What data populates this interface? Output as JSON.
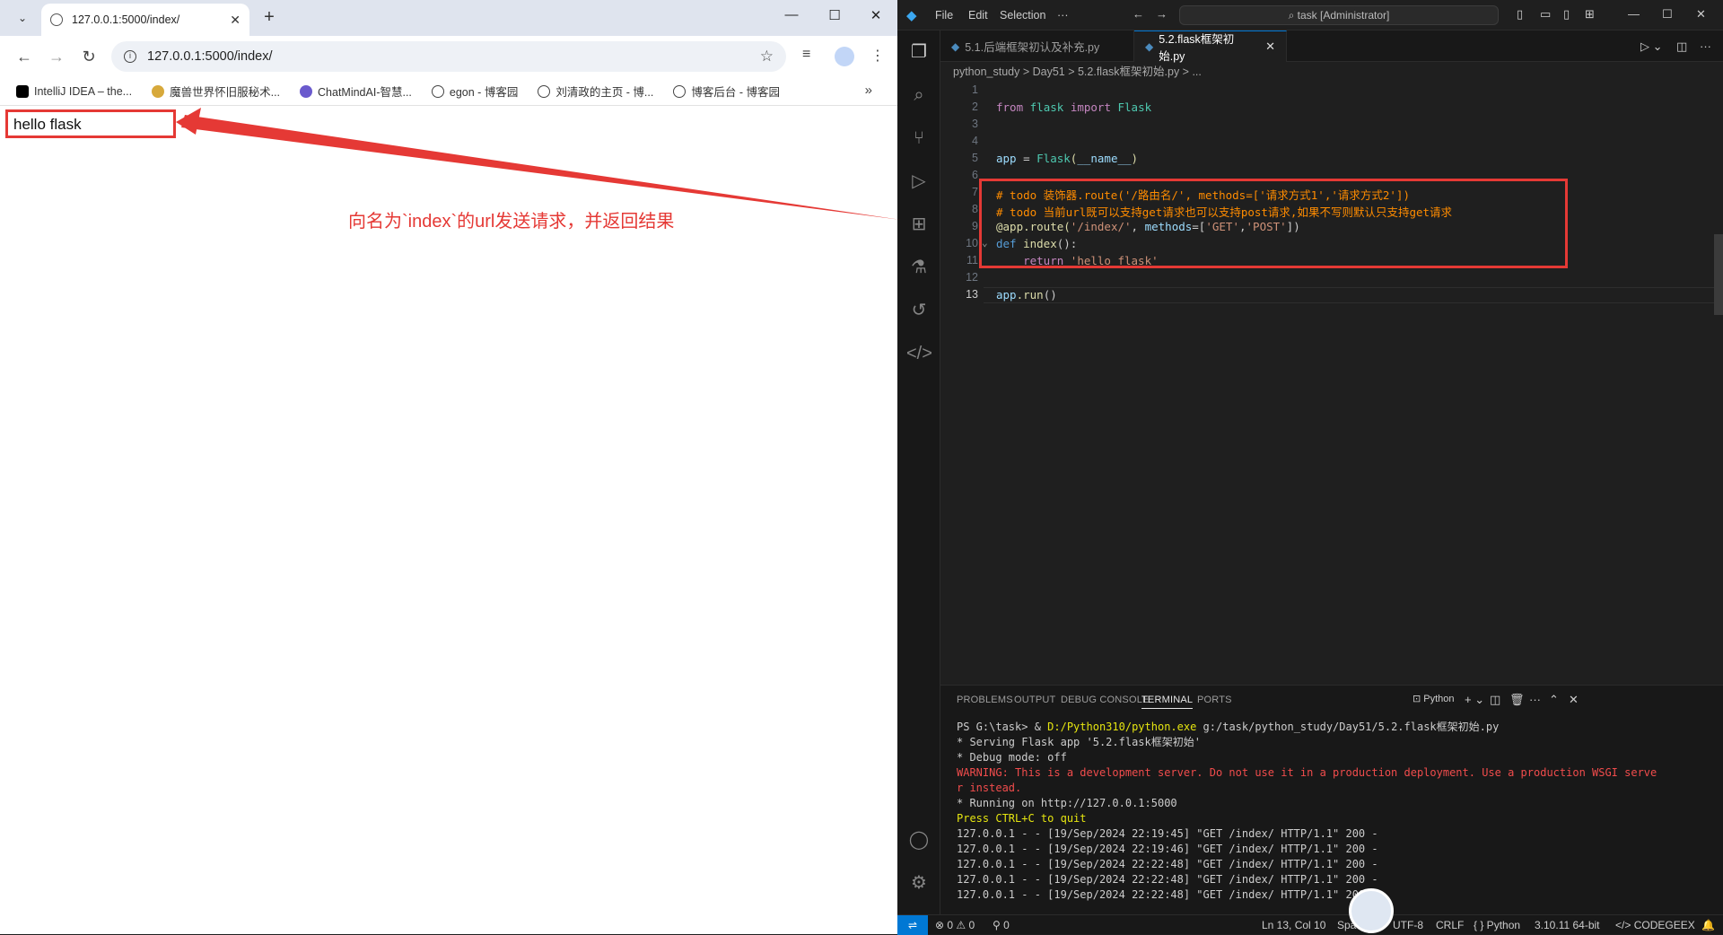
{
  "browser": {
    "tab_title": "127.0.0.1:5000/index/",
    "url": "127.0.0.1:5000/index/",
    "bookmarks": [
      {
        "label": "IntelliJ IDEA – the...",
        "color": "#000000"
      },
      {
        "label": "魔兽世界怀旧服秘术...",
        "color": "#d7a93b"
      },
      {
        "label": "ChatMindAI-智慧...",
        "color": "#6a5acd"
      },
      {
        "label": "egon - 博客园",
        "color": "#444444"
      },
      {
        "label": "刘清政的主页 - 博...",
        "color": "#444444"
      },
      {
        "label": "博客后台 - 博客园",
        "color": "#444444"
      }
    ],
    "page_text": "hello flask",
    "annotation": "向名为`index`的url发送请求，并返回结果"
  },
  "vscode": {
    "menu": [
      "File",
      "Edit",
      "Selection",
      "···"
    ],
    "command_center": "task [Administrator]",
    "tabs": [
      {
        "label": "5.1.后端框架初认及补充.py",
        "active": false
      },
      {
        "label": "5.2.flask框架初始.py",
        "active": true
      }
    ],
    "breadcrumb": "python_study  >  Day51  >  5.2.flask框架初始.py  >  ...",
    "line_numbers": [
      "1",
      "2",
      "3",
      "4",
      "5",
      "6",
      "7",
      "8",
      "9",
      "10",
      "11",
      "12",
      "13"
    ],
    "code": {
      "l2_from": "from",
      "l2_mod": "flask",
      "l2_import": "import",
      "l2_cls": "Flask",
      "l5_var": "app",
      "l5_eq": " = ",
      "l5_cls": "Flask",
      "l5_paren_open": "(",
      "l5_arg": "__name__",
      "l5_paren_close": ")",
      "l7": "# todo 装饰器.route('/路由名/', methods=['请求方式1','请求方式2'])",
      "l8": "# todo 当前url既可以支持get请求也可以支持post请求,如果不写则默认只支持get请求",
      "l9_at": "@app.route(",
      "l9_route": "'/index/'",
      "l9_mid": ", ",
      "l9_kw": "methods",
      "l9_eq": "=[",
      "l9_get": "'GET'",
      "l9_comma": ",",
      "l9_post": "'POST'",
      "l9_end": "])",
      "l10_def": "def",
      "l10_fn": "index",
      "l10_end": "():",
      "l11_ret": "return",
      "l11_str": "'hello flask'",
      "l13_var": "app",
      "l13_fn": ".run",
      "l13_end": "()"
    },
    "panel_tabs": [
      "PROBLEMS",
      "OUTPUT",
      "DEBUG CONSOLE",
      "TERMINAL",
      "PORTS"
    ],
    "terminal_profile": "Python",
    "terminal": {
      "prompt": "PS G:\\task> & ",
      "exe": "D:/Python310/python.exe",
      "script": " g:/task/python_study/Day51/5.2.flask框架初始.py",
      "serving": " * Serving Flask app '5.2.flask框架初始'",
      "debug": " * Debug mode: off",
      "warning1": "WARNING: This is a development server. Do not use it in a production deployment. Use a production WSGI serve",
      "warning2": "r instead.",
      "running": " * Running on http://127.0.0.1:5000",
      "quit": "Press CTRL+C to quit",
      "logs": [
        "127.0.0.1 - - [19/Sep/2024 22:19:45] \"GET /index/ HTTP/1.1\" 200 -",
        "127.0.0.1 - - [19/Sep/2024 22:19:46] \"GET /index/ HTTP/1.1\" 200 -",
        "127.0.0.1 - - [19/Sep/2024 22:22:48] \"GET /index/ HTTP/1.1\" 200 -",
        "127.0.0.1 - - [19/Sep/2024 22:22:48] \"GET /index/ HTTP/1.1\" 200 -",
        "127.0.0.1 - - [19/Sep/2024 22:22:48] \"GET /index/ HTTP/1.1\" 200 -"
      ]
    },
    "status": {
      "problems": "⊗ 0 ⚠ 0",
      "ports": "⚲ 0",
      "position": "Ln 13, Col 10",
      "spaces": "Spac",
      "encoding": "UTF-8",
      "eol": "CRLF",
      "language": "{ }  Python",
      "interpreter": "3.10.11 64-bit",
      "codegeex": "CODEGEEX"
    },
    "colors": {
      "accent": "#0078d4",
      "highlight_box": "#e53935"
    }
  }
}
